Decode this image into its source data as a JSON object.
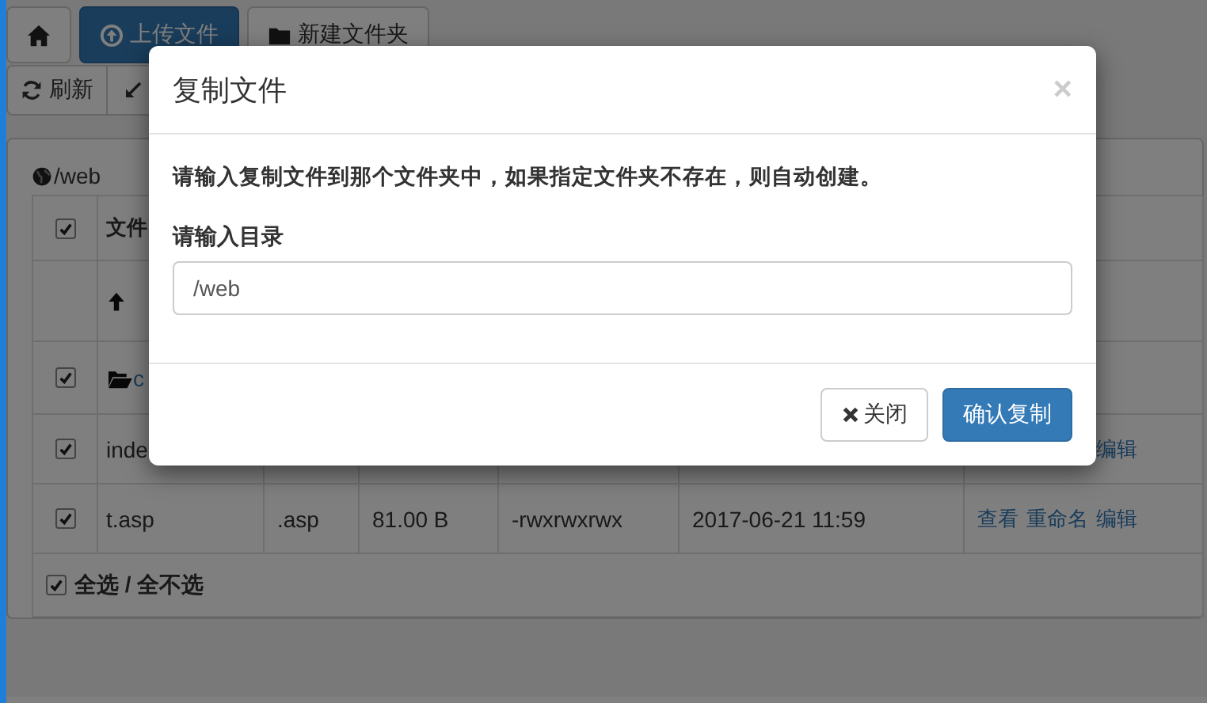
{
  "toolbar": [
    {
      "kind": "home"
    },
    {
      "kind": "upload",
      "label": "上传文件",
      "primary": true
    },
    {
      "kind": "new-folder",
      "label": "新建文件夹",
      "primary": false
    }
  ],
  "toolbar_2": [
    {
      "kind": "refresh",
      "label": "刷新"
    },
    {
      "kind": "resize"
    }
  ],
  "path": "/web",
  "table": {
    "columns": [
      {
        "label": "文件"
      }
    ],
    "header_checked": true,
    "rows": [
      {
        "kind": "up"
      },
      {
        "kind": "folder",
        "checked": true,
        "name": "c"
      },
      {
        "kind": "file",
        "checked": true,
        "name": "inde",
        "actions": [
          {
            "kind": "edit",
            "label": "编辑"
          }
        ]
      },
      {
        "kind": "file",
        "checked": true,
        "name": "t.asp",
        "ext": ".asp",
        "size": "81.00 B",
        "perms": "-rwxrwxrwx",
        "modified": "2017-06-21 11:59",
        "actions": [
          {
            "kind": "view",
            "label": "查看"
          },
          {
            "kind": "rename",
            "label": "重命名"
          },
          {
            "kind": "edit",
            "label": "编辑"
          }
        ]
      }
    ],
    "footer": {
      "checked": true,
      "label": "全选 / 全不选"
    }
  },
  "dialog": {
    "title": "复制文件",
    "close": "×",
    "message": "请输入复制文件到那个文件夹中，如果指定文件夹不存在，则自动创建。",
    "field_label": "请输入目录",
    "value": "/web",
    "buttons": [
      {
        "kind": "default",
        "label": "关闭"
      },
      {
        "kind": "primary",
        "label": "确认复制"
      }
    ]
  }
}
